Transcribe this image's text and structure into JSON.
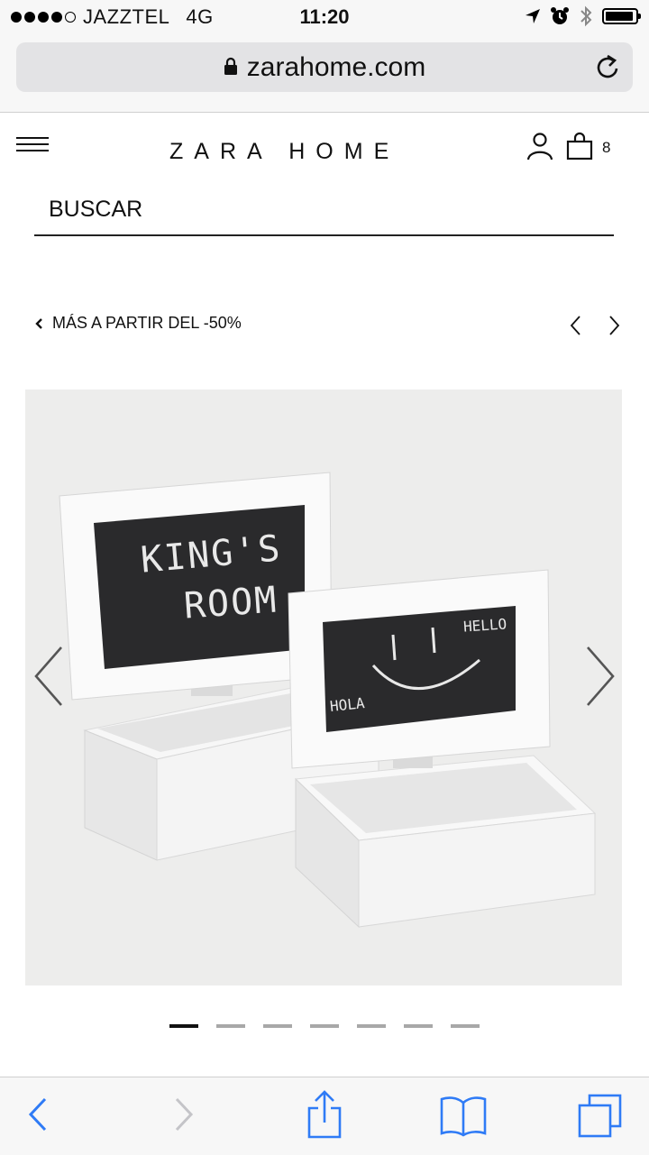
{
  "status_bar": {
    "carrier": "JAZZTEL",
    "network": "4G",
    "time": "11:20",
    "signal_bars": 4,
    "signal_max": 5,
    "battery_level": 0.95
  },
  "browser": {
    "url": "zarahome.com"
  },
  "header": {
    "logo": "ZARA HOME",
    "bag_count": "8"
  },
  "search": {
    "label": "BUSCAR"
  },
  "breadcrumb": {
    "label": "MÁS A PARTIR DEL -50%"
  },
  "product": {
    "board_left_text_1": "KING'S",
    "board_left_text_2": "ROOM",
    "board_right_text_1": "HELLO",
    "board_right_text_2": "HOLA"
  },
  "carousel": {
    "count": 7,
    "active": 0
  },
  "colors": {
    "accent": "#2f7bf6",
    "text": "#111111",
    "chrome": "#f7f7f7",
    "chalkboard": "#2a2a2c"
  },
  "icons": {
    "menu": "hamburger-icon",
    "user": "user-icon",
    "bag": "shopping-bag-icon",
    "lock": "lock-icon",
    "reload": "reload-icon",
    "back": "back-icon",
    "forward": "forward-icon",
    "share": "share-icon",
    "bookmarks": "bookmarks-icon",
    "tabs": "tabs-icon"
  }
}
